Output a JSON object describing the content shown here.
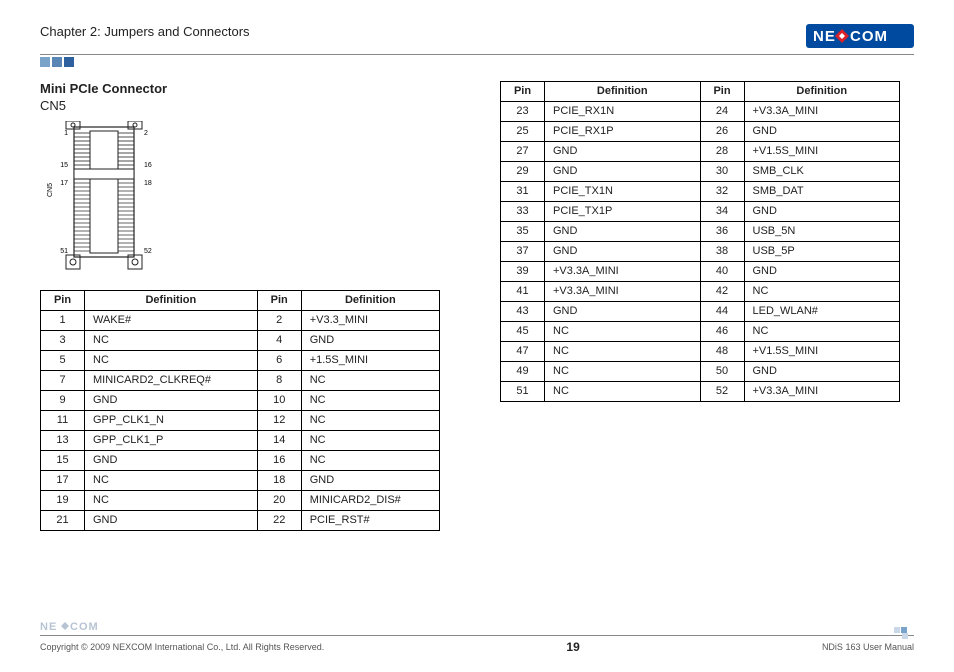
{
  "header": {
    "chapter_title": "Chapter 2: Jumpers and Connectors",
    "logo_text": "NEXCOM"
  },
  "section": {
    "title": "Mini PCIe Connector",
    "subtitle": "CN5"
  },
  "diagram": {
    "label_left_top": "1",
    "label_left_bottom": "51",
    "label_right_top": "2",
    "label_right_bottom": "52",
    "label_gap_left_top": "15",
    "label_gap_left_bottom": "17",
    "label_gap_right_top": "16",
    "label_gap_right_bottom": "18",
    "label_side": "CN5"
  },
  "table_headers": {
    "pin": "Pin",
    "def": "Definition"
  },
  "table1": [
    {
      "p1": "1",
      "d1": "WAKE#",
      "p2": "2",
      "d2": "+V3.3_MINI"
    },
    {
      "p1": "3",
      "d1": "NC",
      "p2": "4",
      "d2": "GND"
    },
    {
      "p1": "5",
      "d1": "NC",
      "p2": "6",
      "d2": "+1.5S_MINI"
    },
    {
      "p1": "7",
      "d1": "MINICARD2_CLKREQ#",
      "p2": "8",
      "d2": "NC"
    },
    {
      "p1": "9",
      "d1": "GND",
      "p2": "10",
      "d2": "NC"
    },
    {
      "p1": "11",
      "d1": "GPP_CLK1_N",
      "p2": "12",
      "d2": "NC"
    },
    {
      "p1": "13",
      "d1": "GPP_CLK1_P",
      "p2": "14",
      "d2": "NC"
    },
    {
      "p1": "15",
      "d1": "GND",
      "p2": "16",
      "d2": "NC"
    },
    {
      "p1": "17",
      "d1": "NC",
      "p2": "18",
      "d2": "GND"
    },
    {
      "p1": "19",
      "d1": "NC",
      "p2": "20",
      "d2": "MINICARD2_DIS#"
    },
    {
      "p1": "21",
      "d1": "GND",
      "p2": "22",
      "d2": "PCIE_RST#"
    }
  ],
  "table2": [
    {
      "p1": "23",
      "d1": "PCIE_RX1N",
      "p2": "24",
      "d2": "+V3.3A_MINI"
    },
    {
      "p1": "25",
      "d1": "PCIE_RX1P",
      "p2": "26",
      "d2": "GND"
    },
    {
      "p1": "27",
      "d1": "GND",
      "p2": "28",
      "d2": "+V1.5S_MINI"
    },
    {
      "p1": "29",
      "d1": "GND",
      "p2": "30",
      "d2": "SMB_CLK"
    },
    {
      "p1": "31",
      "d1": "PCIE_TX1N",
      "p2": "32",
      "d2": "SMB_DAT"
    },
    {
      "p1": "33",
      "d1": "PCIE_TX1P",
      "p2": "34",
      "d2": "GND"
    },
    {
      "p1": "35",
      "d1": "GND",
      "p2": "36",
      "d2": "USB_5N"
    },
    {
      "p1": "37",
      "d1": "GND",
      "p2": "38",
      "d2": "USB_5P"
    },
    {
      "p1": "39",
      "d1": "+V3.3A_MINI",
      "p2": "40",
      "d2": "GND"
    },
    {
      "p1": "41",
      "d1": "+V3.3A_MINI",
      "p2": "42",
      "d2": "NC"
    },
    {
      "p1": "43",
      "d1": "GND",
      "p2": "44",
      "d2": "LED_WLAN#"
    },
    {
      "p1": "45",
      "d1": "NC",
      "p2": "46",
      "d2": "NC"
    },
    {
      "p1": "47",
      "d1": "NC",
      "p2": "48",
      "d2": "+V1.5S_MINI"
    },
    {
      "p1": "49",
      "d1": "NC",
      "p2": "50",
      "d2": "GND"
    },
    {
      "p1": "51",
      "d1": "NC",
      "p2": "52",
      "d2": "+V3.3A_MINI"
    }
  ],
  "footer": {
    "logo_text": "NEXCOM",
    "copyright": "Copyright © 2009 NEXCOM International Co., Ltd. All Rights Reserved.",
    "page": "19",
    "manual": "NDiS 163 User Manual"
  },
  "colors": {
    "logo_bg": "#004a9f",
    "logo_red": "#d8232a",
    "sq1": "#7aa3c9",
    "sq2": "#5a86b5",
    "sq3": "#2e5f9e"
  }
}
